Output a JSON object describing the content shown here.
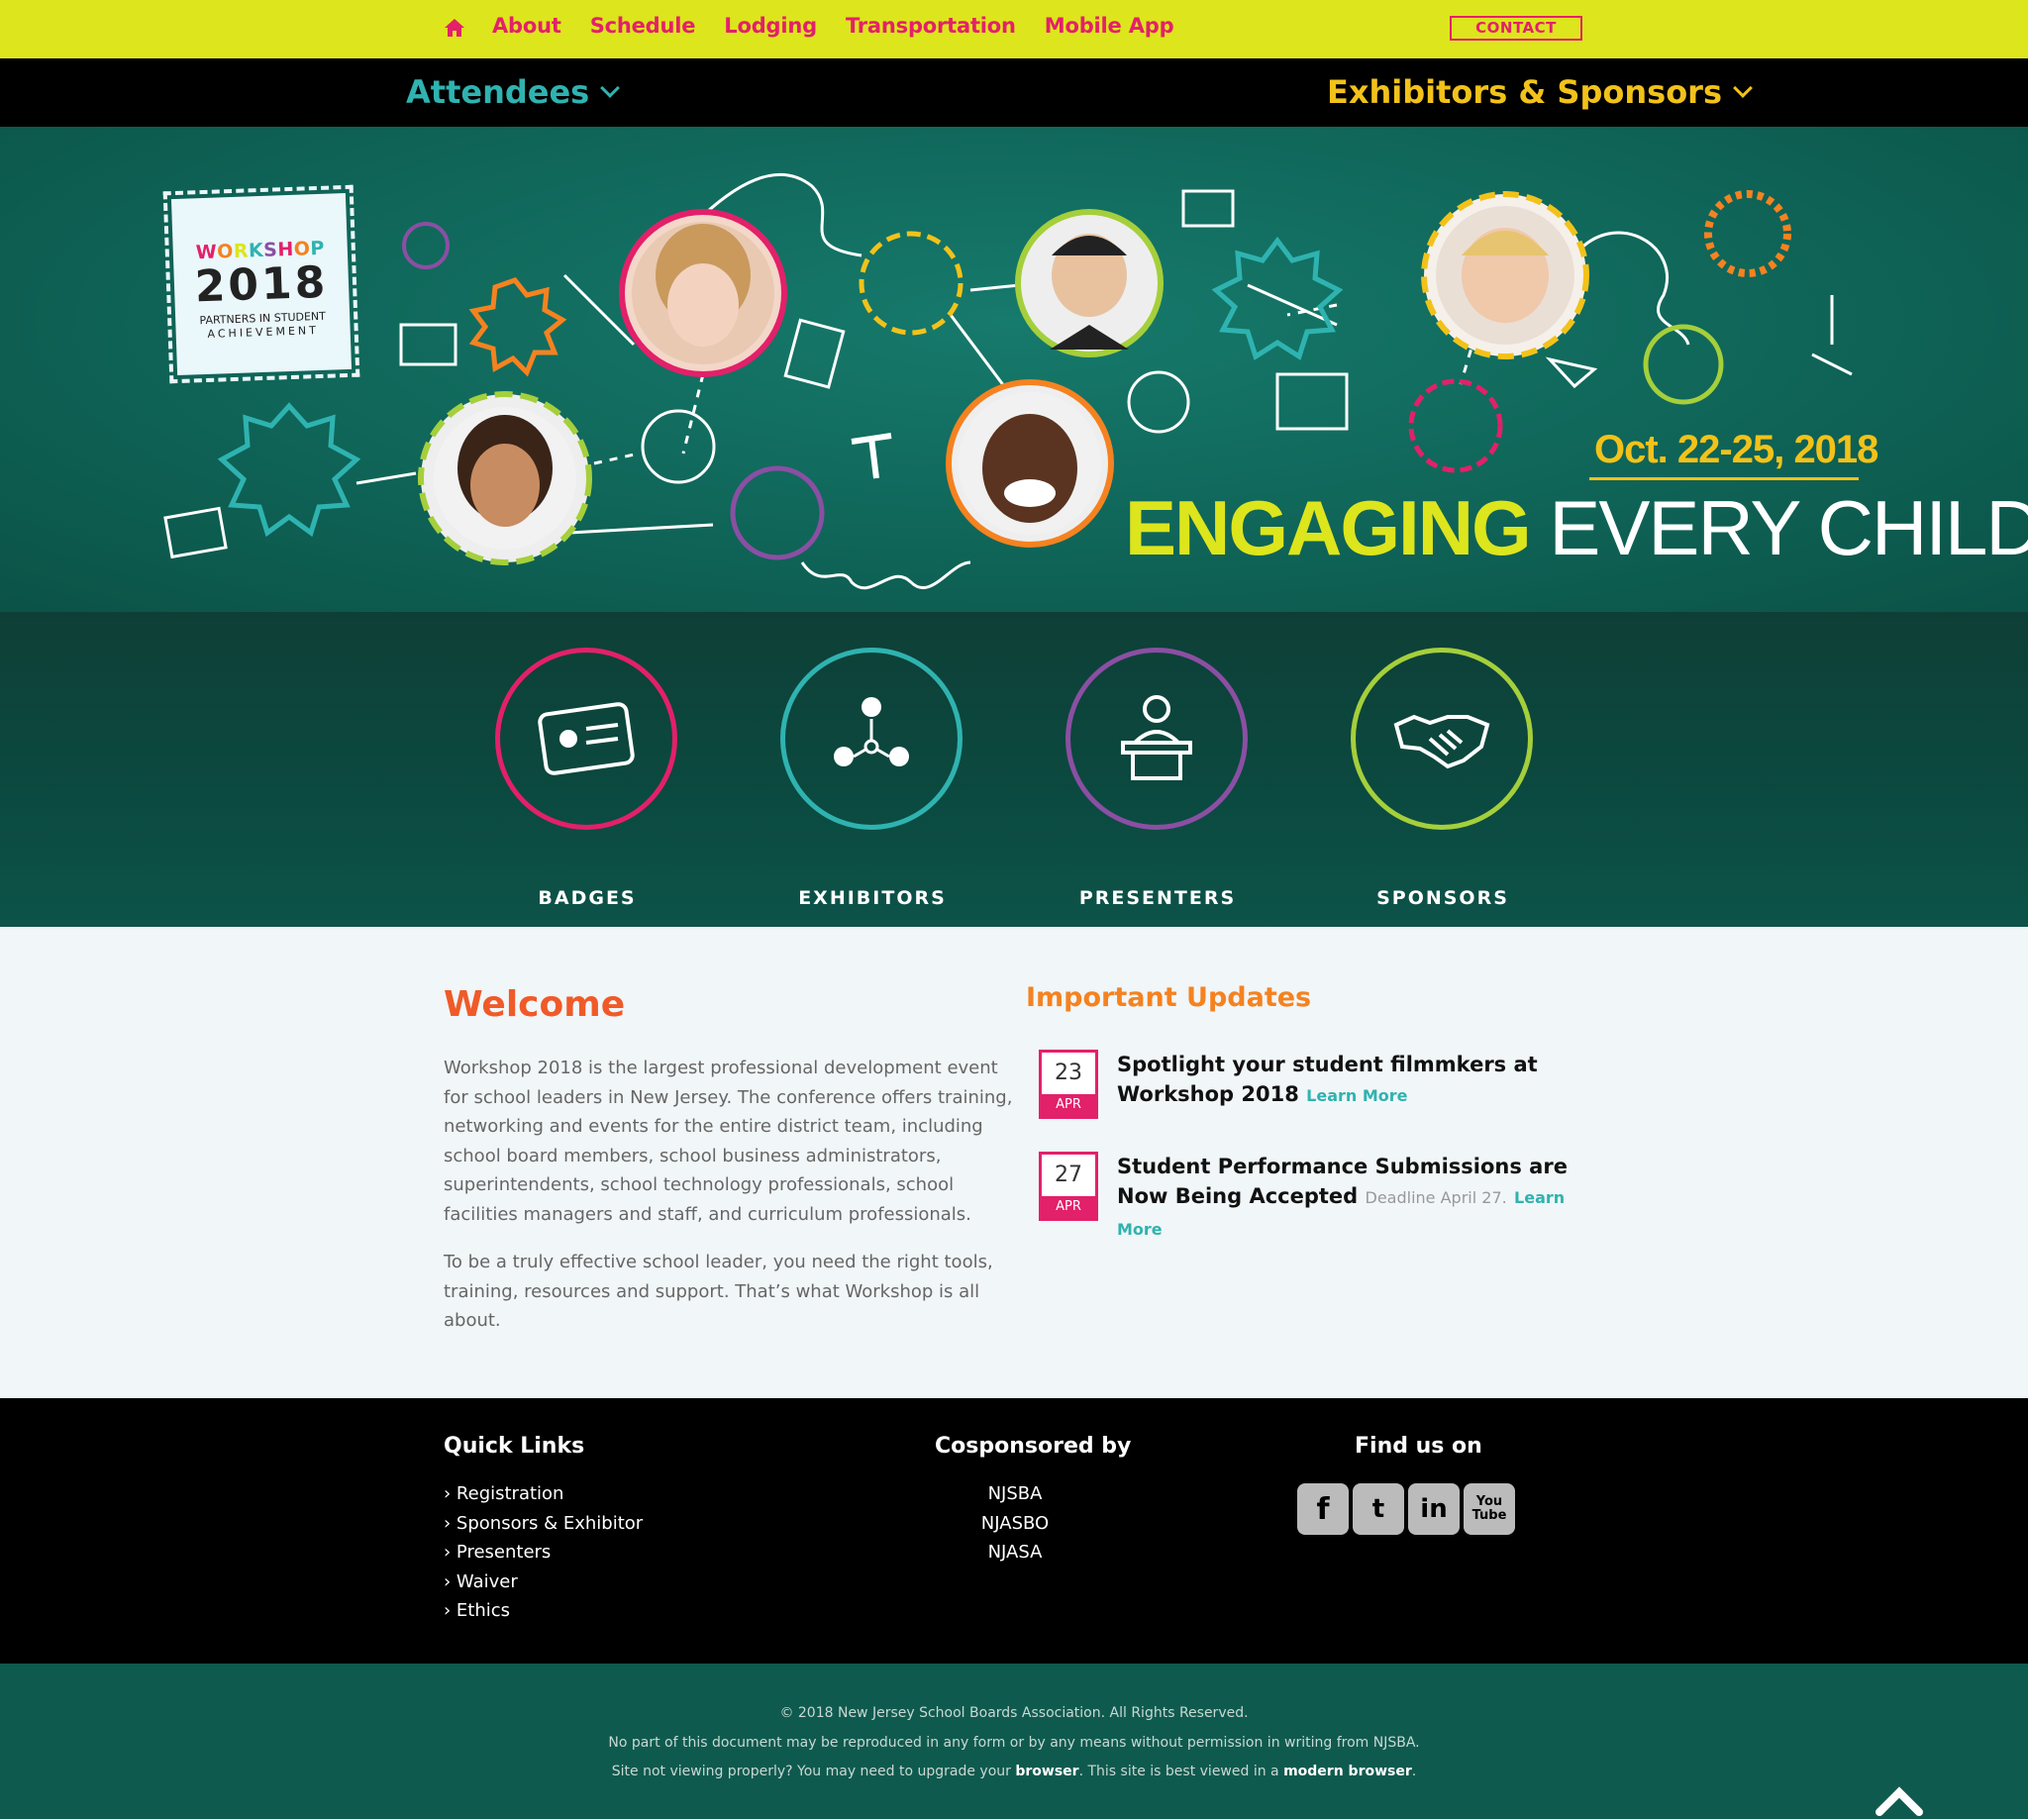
{
  "topnav": {
    "links": [
      "About",
      "Schedule",
      "Lodging",
      "Transportation",
      "Mobile App"
    ],
    "contact": "CONTACT",
    "accent": "#e3206a",
    "bg": "#dde51c"
  },
  "subnav": {
    "attendees": "Attendees",
    "exhibitors": "Exhibitors & Sponsors"
  },
  "hero": {
    "logo": {
      "word": "WORKSHOP",
      "year": "2018",
      "line1": "PARTNERS IN STUDENT",
      "line2": "ACHIEVEMENT"
    },
    "date": "Oct. 22-25, 2018",
    "tagline_a": "ENGAGING",
    "tagline_b": "EVERY CHILD"
  },
  "band": {
    "items": [
      {
        "label": "BADGES",
        "color": "#e3206a",
        "icon": "id-badge-icon"
      },
      {
        "label": "EXHIBITORS",
        "color": "#2fb3b0",
        "icon": "network-icon"
      },
      {
        "label": "PRESENTERS",
        "color": "#8b4fa3",
        "icon": "podium-icon"
      },
      {
        "label": "SPONSORS",
        "color": "#a5cf3b",
        "icon": "handshake-icon"
      }
    ]
  },
  "welcome": {
    "title": "Welcome",
    "p1": "Workshop 2018 is the largest professional development event for school leaders in New Jersey. The conference offers training, networking and events for the entire district team, including school board members, school business administrators, superintendents, school technology professionals, school facilities managers and staff, and curriculum professionals.",
    "p2": "To be a truly effective school leader, you need the right tools, training, resources and support. That’s what Workshop is all about."
  },
  "updates": {
    "title": "Important Updates",
    "items": [
      {
        "day": "23",
        "month": "APR",
        "text": "Spotlight your student filmmkers at Workshop 2018",
        "note": "",
        "link": "Learn More"
      },
      {
        "day": "27",
        "month": "APR",
        "text": "Student Performance Submissions are Now Being Accepted",
        "note": "Deadline April 27.",
        "link": "Learn More"
      }
    ]
  },
  "footer": {
    "quick_title": "Quick Links",
    "quick_links": [
      "Registration",
      "Sponsors & Exhibitor",
      "Presenters",
      "Waiver",
      "Ethics"
    ],
    "co_title": "Cosponsored by",
    "cosponsors": [
      "NJSBA",
      "NJASBO",
      "NJASA"
    ],
    "find_title": "Find us on",
    "social": [
      "facebook-icon",
      "twitter-icon",
      "linkedin-icon",
      "youtube-icon"
    ]
  },
  "bottom": {
    "copyright": "© 2018 New Jersey School Boards Association. All Rights Reserved.",
    "notice": "No part of this document may be reproduced in any form or by any means without permission in writing from NJSBA.",
    "upgrade_a": "Site not viewing properly? You may need to upgrade your ",
    "upgrade_b": "browser",
    "upgrade_c": ". This site is best viewed in a ",
    "upgrade_d": "modern browser",
    "upgrade_e": "."
  }
}
